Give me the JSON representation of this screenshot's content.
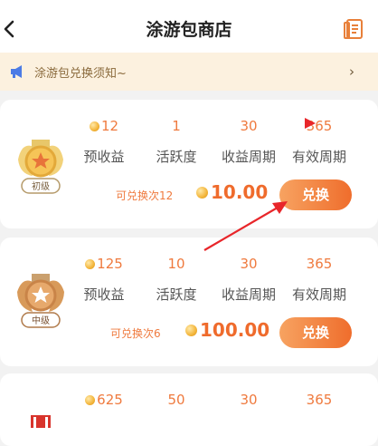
{
  "header": {
    "title": "涂游包商店",
    "back_icon": "chevron-left-icon",
    "doc_icon": "document-icon"
  },
  "notice": {
    "text": "涂游包兑换须知~",
    "icon": "megaphone-icon",
    "chevron": "›"
  },
  "stat_labels": [
    "预收益",
    "活跃度",
    "收益周期",
    "有效周期"
  ],
  "cards": [
    {
      "level": "初级",
      "expected_income": "12",
      "activity": "1",
      "income_period": "30",
      "valid_period": "365",
      "remaining": "可兑换次12",
      "price": "10.00",
      "button": "兑换"
    },
    {
      "level": "中级",
      "expected_income": "125",
      "activity": "10",
      "income_period": "30",
      "valid_period": "365",
      "remaining": "可兑换次6",
      "price": "100.00",
      "button": "兑换"
    },
    {
      "level": "",
      "expected_income": "625",
      "activity": "50",
      "income_period": "30",
      "valid_period": "365"
    }
  ],
  "colors": {
    "accent": "#ef6d2c",
    "accent_light": "#f7a361",
    "notice_bg": "#fcf1df",
    "page_bg": "#f2f2f2"
  }
}
